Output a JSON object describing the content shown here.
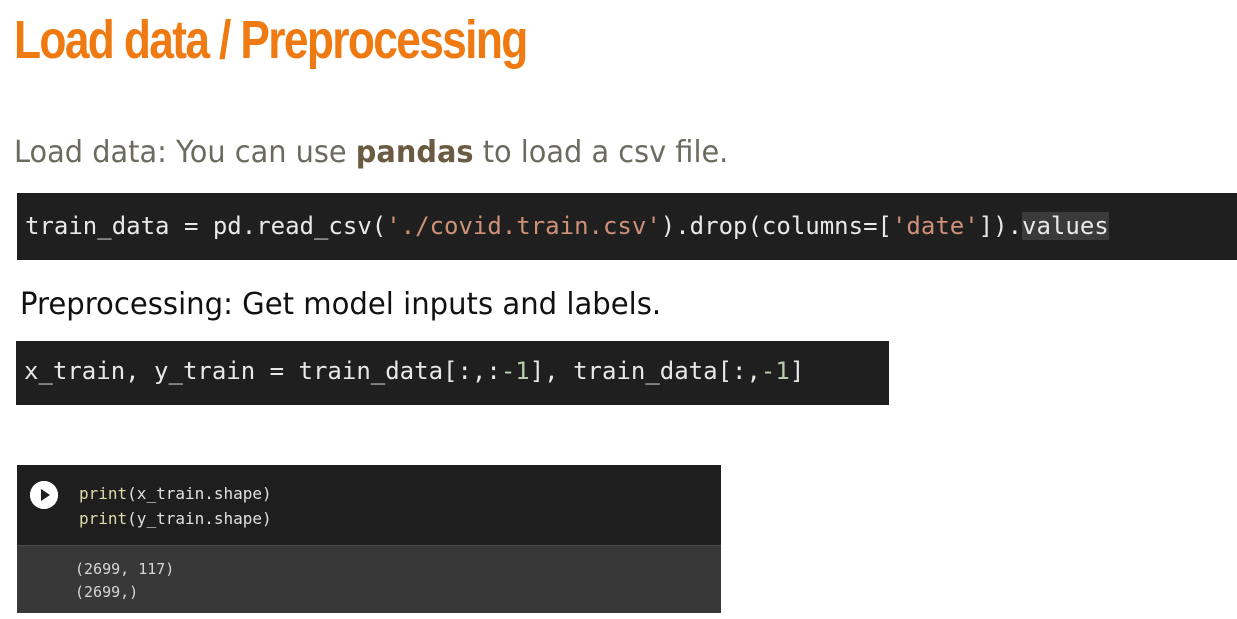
{
  "title": "Load data / Preprocessing",
  "intro": {
    "prefix": "Load data: You can use ",
    "bold": "pandas",
    "suffix": " to load a csv file."
  },
  "code1": {
    "part1": "train_data = pd.read_csv(",
    "string1": "'./covid.train.csv'",
    "part2": ").drop(columns=[",
    "string2": "'date'",
    "part3": "]).",
    "highlight": "values"
  },
  "preprocessing_text": "Preprocessing: Get model inputs and labels.",
  "code2": {
    "part1": "x_train, y_train = train_data[:,:",
    "num1": "-1",
    "part2": "], train_data[:,",
    "num2": "-1",
    "part3": "]"
  },
  "cell": {
    "input_lines": [
      {
        "fn": "print",
        "rest": "(x_train.shape)"
      },
      {
        "fn": "print",
        "rest": "(y_train.shape)"
      }
    ],
    "output_lines": [
      "(2699, 117)",
      "(2699,)"
    ],
    "run_icon": "play-circle-icon"
  },
  "colors": {
    "title": "#f07a12",
    "code_bg": "#1f1f1f",
    "string": "#ce9178",
    "number": "#b5cea8"
  }
}
